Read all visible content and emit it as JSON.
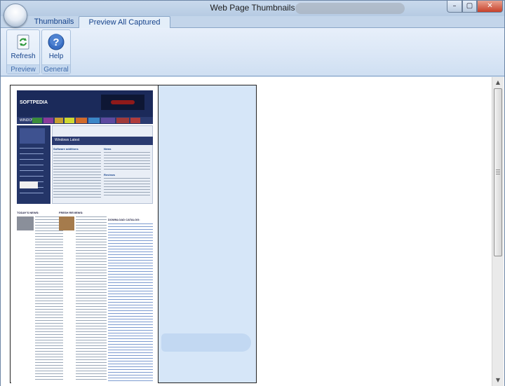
{
  "window": {
    "title": "Web Page Thumbnails",
    "controls": {
      "minimize": "–",
      "maximize": "▢",
      "close": "✕"
    }
  },
  "tabs": [
    {
      "label": "Thumbnails",
      "active": false
    },
    {
      "label": "Preview All Captured Images",
      "active": true
    }
  ],
  "ribbon": {
    "groups": [
      {
        "label": "Preview",
        "buttons": [
          {
            "label": "Refresh",
            "icon": "refresh-icon"
          }
        ]
      },
      {
        "label": "General",
        "buttons": [
          {
            "label": "Help",
            "icon": "help-icon"
          }
        ]
      }
    ]
  },
  "scrollbar": {
    "up": "▲",
    "down": "▼"
  },
  "thumbnail": {
    "logo": "SOFTPEDIA",
    "nav": [
      "WINDOWS",
      "GAMES",
      "DRIVERS",
      "MAC",
      "LINUX",
      "SCRIPTS",
      "MOBILE",
      "HANDHELD",
      "GADGETS",
      "NEWS"
    ],
    "panel_title": "Windows Latest",
    "software_additions": "Software additions",
    "news": "News",
    "reviews": "Reviews",
    "todays_news": "TODAY'S NEWS:",
    "fresh_reviews": "FRESH REVIEWS:",
    "download_catalog": "DOWNLOAD CATALOG:"
  },
  "colors": {
    "accent": "#15428b",
    "ribbon": "#dbe7f6",
    "close": "#c7412a",
    "site_nav": "#2b3b70"
  }
}
